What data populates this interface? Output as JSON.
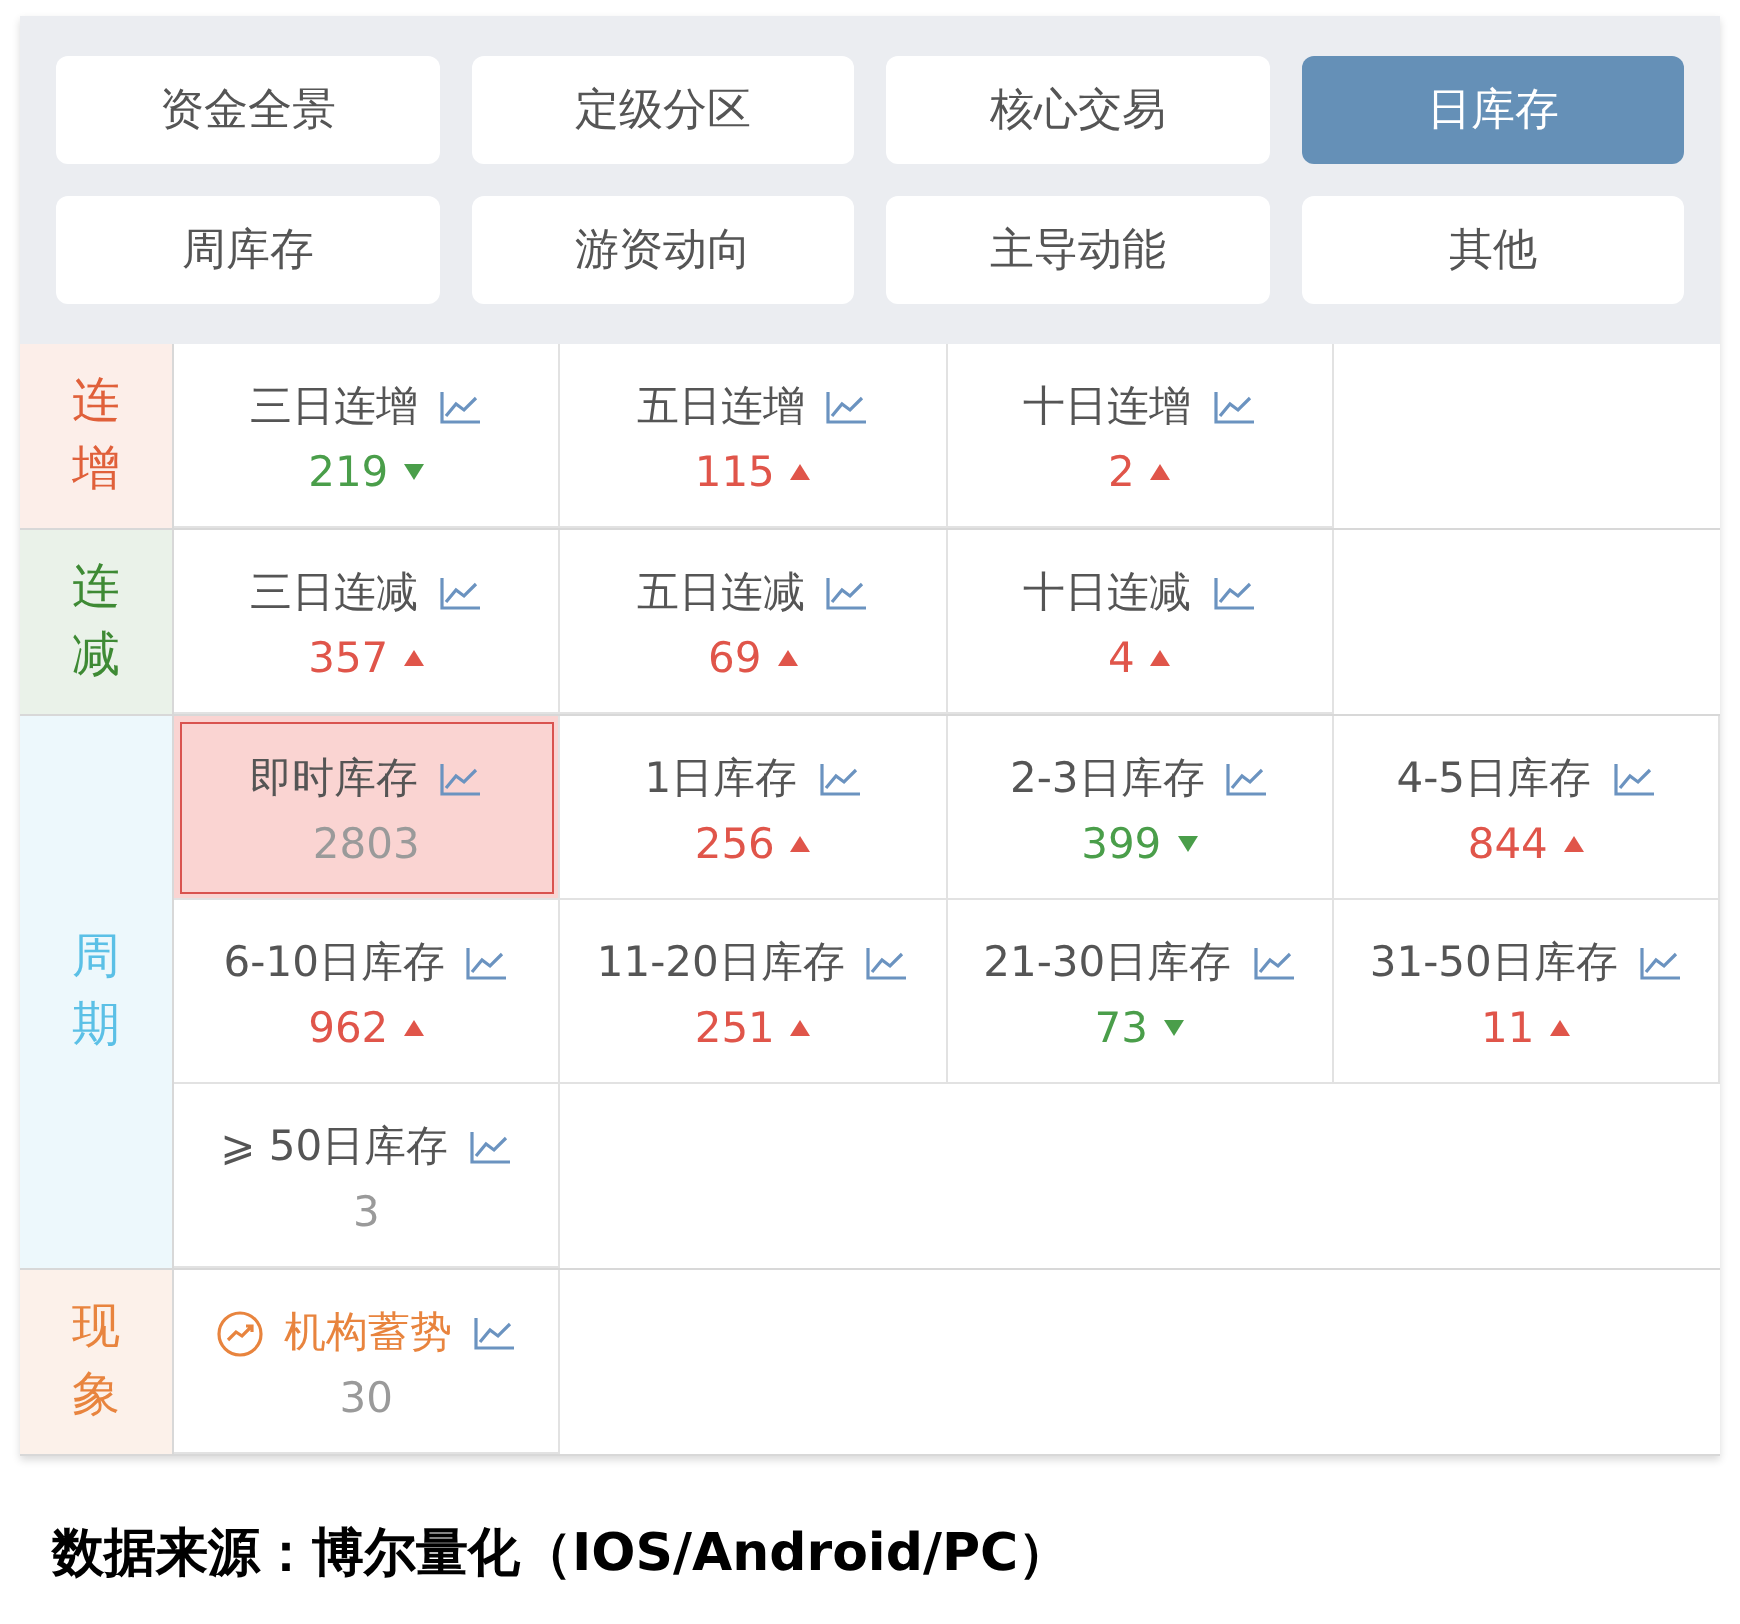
{
  "tabs": [
    {
      "label": "资金全景",
      "selected": false
    },
    {
      "label": "定级分区",
      "selected": false
    },
    {
      "label": "核心交易",
      "selected": false
    },
    {
      "label": "日库存",
      "selected": true
    },
    {
      "label": "周库存",
      "selected": false
    },
    {
      "label": "游资动向",
      "selected": false
    },
    {
      "label": "主导动能",
      "selected": false
    },
    {
      "label": "其他",
      "selected": false
    }
  ],
  "groups": [
    {
      "label": "连增",
      "color": "#e0603a",
      "items": [
        {
          "name": "三日连增",
          "value": "219",
          "kind": "down",
          "selected": false,
          "featured": false
        },
        {
          "name": "五日连增",
          "value": "115",
          "kind": "up",
          "selected": false,
          "featured": false
        },
        {
          "name": "十日连增",
          "value": "2",
          "kind": "up",
          "selected": false,
          "featured": false
        }
      ]
    },
    {
      "label": "连减",
      "color": "#3e8a34",
      "items": [
        {
          "name": "三日连减",
          "value": "357",
          "kind": "up",
          "selected": false,
          "featured": false
        },
        {
          "name": "五日连减",
          "value": "69",
          "kind": "up",
          "selected": false,
          "featured": false
        },
        {
          "name": "十日连减",
          "value": "4",
          "kind": "up",
          "selected": false,
          "featured": false
        }
      ]
    },
    {
      "label": "周期",
      "color": "#5bc0e6",
      "items": [
        {
          "name": "即时库存",
          "value": "2803",
          "kind": "plain",
          "selected": true,
          "featured": false
        },
        {
          "name": "1日库存",
          "value": "256",
          "kind": "up",
          "selected": false,
          "featured": false
        },
        {
          "name": "2-3日库存",
          "value": "399",
          "kind": "down",
          "selected": false,
          "featured": false
        },
        {
          "name": "4-5日库存",
          "value": "844",
          "kind": "up",
          "selected": false,
          "featured": false
        },
        {
          "name": "6-10日库存",
          "value": "962",
          "kind": "up",
          "selected": false,
          "featured": false
        },
        {
          "name": "11-20日库存",
          "value": "251",
          "kind": "up",
          "selected": false,
          "featured": false
        },
        {
          "name": "21-30日库存",
          "value": "73",
          "kind": "down",
          "selected": false,
          "featured": false
        },
        {
          "name": "31-50日库存",
          "value": "11",
          "kind": "up",
          "selected": false,
          "featured": false
        },
        {
          "name": "⩾ 50日库存",
          "value": "3",
          "kind": "plain",
          "selected": false,
          "featured": false
        }
      ]
    },
    {
      "label": "现象",
      "color": "#e8843e",
      "items": [
        {
          "name": "机构蓄势",
          "value": "30",
          "kind": "plain",
          "selected": false,
          "featured": true
        }
      ]
    }
  ],
  "source": "数据来源：博尔量化（IOS/Android/PC）"
}
